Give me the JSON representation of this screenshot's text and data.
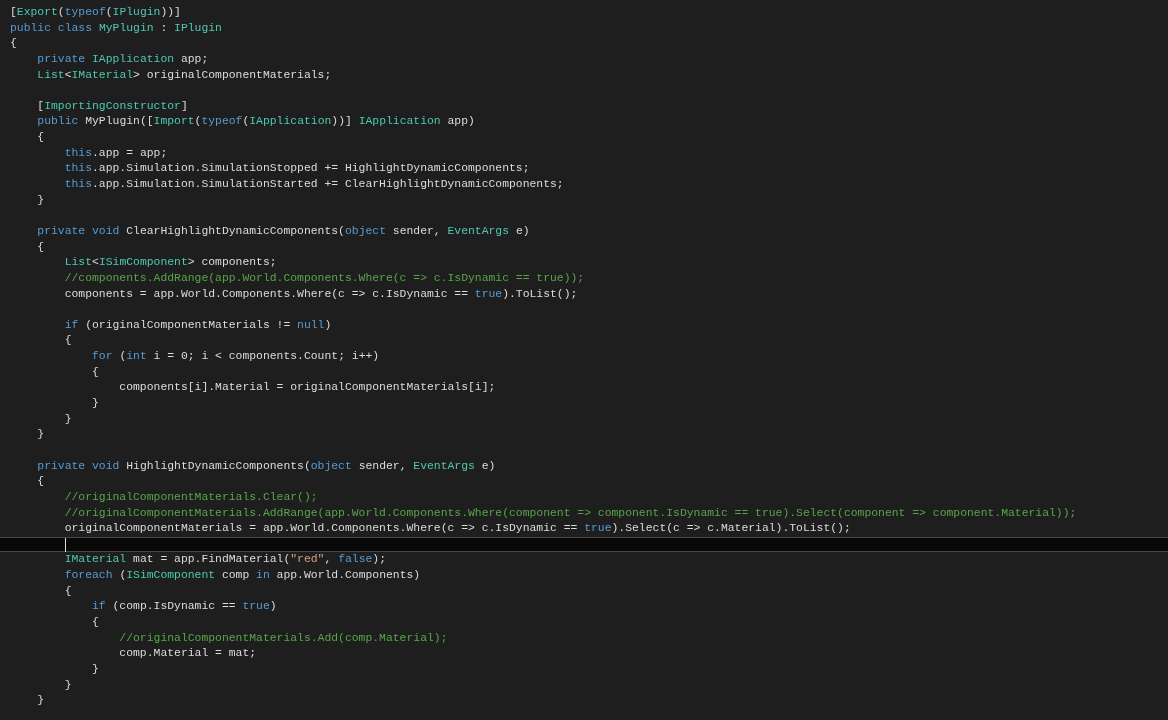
{
  "editor": {
    "lines": [
      {
        "current": false,
        "tokens": [
          {
            "text": "[",
            "kind": "plain"
          },
          {
            "text": "Export",
            "kind": "type"
          },
          {
            "text": "(",
            "kind": "plain"
          },
          {
            "text": "typeof",
            "kind": "keyword"
          },
          {
            "text": "(",
            "kind": "plain"
          },
          {
            "text": "IPlugin",
            "kind": "type"
          },
          {
            "text": "))]",
            "kind": "plain"
          }
        ]
      },
      {
        "current": false,
        "tokens": [
          {
            "text": "public class ",
            "kind": "keyword"
          },
          {
            "text": "MyPlugin",
            "kind": "type"
          },
          {
            "text": " : ",
            "kind": "plain"
          },
          {
            "text": "IPlugin",
            "kind": "type"
          }
        ]
      },
      {
        "current": false,
        "tokens": [
          {
            "text": "{",
            "kind": "plain"
          }
        ]
      },
      {
        "current": false,
        "tokens": [
          {
            "text": "    private ",
            "kind": "keyword"
          },
          {
            "text": "IApplication",
            "kind": "type"
          },
          {
            "text": " app;",
            "kind": "plain"
          }
        ]
      },
      {
        "current": false,
        "tokens": [
          {
            "text": "    List",
            "kind": "type"
          },
          {
            "text": "<",
            "kind": "plain"
          },
          {
            "text": "IMaterial",
            "kind": "type"
          },
          {
            "text": "> originalComponentMaterials;",
            "kind": "plain"
          }
        ]
      },
      {
        "current": false
      },
      {
        "current": false,
        "tokens": [
          {
            "text": "    [",
            "kind": "plain"
          },
          {
            "text": "ImportingConstructor",
            "kind": "type"
          },
          {
            "text": "]",
            "kind": "plain"
          }
        ]
      },
      {
        "current": false,
        "tokens": [
          {
            "text": "    public ",
            "kind": "keyword"
          },
          {
            "text": "MyPlugin([",
            "kind": "plain"
          },
          {
            "text": "Import",
            "kind": "type"
          },
          {
            "text": "(",
            "kind": "plain"
          },
          {
            "text": "typeof",
            "kind": "keyword"
          },
          {
            "text": "(",
            "kind": "plain"
          },
          {
            "text": "IApplication",
            "kind": "type"
          },
          {
            "text": "))] ",
            "kind": "plain"
          },
          {
            "text": "IApplication",
            "kind": "type"
          },
          {
            "text": " app)",
            "kind": "plain"
          }
        ]
      },
      {
        "current": false,
        "tokens": [
          {
            "text": "    {",
            "kind": "plain"
          }
        ]
      },
      {
        "current": false,
        "tokens": [
          {
            "text": "        this",
            "kind": "keyword"
          },
          {
            "text": ".app = app;",
            "kind": "plain"
          }
        ]
      },
      {
        "current": false,
        "tokens": [
          {
            "text": "        this",
            "kind": "keyword"
          },
          {
            "text": ".app.Simulation.SimulationStopped += HighlightDynamicComponents;",
            "kind": "plain"
          }
        ]
      },
      {
        "current": false,
        "tokens": [
          {
            "text": "        this",
            "kind": "keyword"
          },
          {
            "text": ".app.Simulation.SimulationStarted += ClearHighlightDynamicComponents;",
            "kind": "plain"
          }
        ]
      },
      {
        "current": false,
        "tokens": [
          {
            "text": "    }",
            "kind": "plain"
          }
        ]
      },
      {
        "current": false
      },
      {
        "current": false,
        "tokens": [
          {
            "text": "    private void ",
            "kind": "keyword"
          },
          {
            "text": "ClearHighlightDynamicComponents(",
            "kind": "plain"
          },
          {
            "text": "object",
            "kind": "keyword"
          },
          {
            "text": " sender, ",
            "kind": "plain"
          },
          {
            "text": "EventArgs",
            "kind": "type"
          },
          {
            "text": " e)",
            "kind": "plain"
          }
        ]
      },
      {
        "current": false,
        "tokens": [
          {
            "text": "    {",
            "kind": "plain"
          }
        ]
      },
      {
        "current": false,
        "tokens": [
          {
            "text": "        List",
            "kind": "type"
          },
          {
            "text": "<",
            "kind": "plain"
          },
          {
            "text": "ISimComponent",
            "kind": "type"
          },
          {
            "text": "> components;",
            "kind": "plain"
          }
        ]
      },
      {
        "current": false,
        "tokens": [
          {
            "text": "        //components.AddRange(app.World.Components.Where(c => c.IsDynamic == true));",
            "kind": "comment"
          }
        ]
      },
      {
        "current": false,
        "tokens": [
          {
            "text": "        components = app.World.Components.Where(c => c.IsDynamic == ",
            "kind": "plain"
          },
          {
            "text": "true",
            "kind": "keyword"
          },
          {
            "text": ").ToList();",
            "kind": "plain"
          }
        ]
      },
      {
        "current": false
      },
      {
        "current": false,
        "tokens": [
          {
            "text": "        if",
            "kind": "keyword"
          },
          {
            "text": " (originalComponentMaterials != ",
            "kind": "plain"
          },
          {
            "text": "null",
            "kind": "keyword"
          },
          {
            "text": ")",
            "kind": "plain"
          }
        ]
      },
      {
        "current": false,
        "tokens": [
          {
            "text": "        {",
            "kind": "plain"
          }
        ]
      },
      {
        "current": false,
        "tokens": [
          {
            "text": "            for",
            "kind": "keyword"
          },
          {
            "text": " (",
            "kind": "plain"
          },
          {
            "text": "int",
            "kind": "keyword"
          },
          {
            "text": " i = 0; i < components.Count; i++)",
            "kind": "plain"
          }
        ]
      },
      {
        "current": false,
        "tokens": [
          {
            "text": "            {",
            "kind": "plain"
          }
        ]
      },
      {
        "current": false,
        "tokens": [
          {
            "text": "                components[i].Material = originalComponentMaterials[i];",
            "kind": "plain"
          }
        ]
      },
      {
        "current": false,
        "tokens": [
          {
            "text": "            }",
            "kind": "plain"
          }
        ]
      },
      {
        "current": false,
        "tokens": [
          {
            "text": "        }",
            "kind": "plain"
          }
        ]
      },
      {
        "current": false,
        "tokens": [
          {
            "text": "    }",
            "kind": "plain"
          }
        ]
      },
      {
        "current": false
      },
      {
        "current": false,
        "tokens": [
          {
            "text": "    private void ",
            "kind": "keyword"
          },
          {
            "text": "HighlightDynamicComponents(",
            "kind": "plain"
          },
          {
            "text": "object",
            "kind": "keyword"
          },
          {
            "text": " sender, ",
            "kind": "plain"
          },
          {
            "text": "EventArgs",
            "kind": "type"
          },
          {
            "text": " e)",
            "kind": "plain"
          }
        ]
      },
      {
        "current": false,
        "tokens": [
          {
            "text": "    {",
            "kind": "plain"
          }
        ]
      },
      {
        "current": false,
        "tokens": [
          {
            "text": "        //originalComponentMaterials.Clear();",
            "kind": "comment"
          }
        ]
      },
      {
        "current": false,
        "tokens": [
          {
            "text": "        //originalComponentMaterials.AddRange(app.World.Components.Where(component => component.IsDynamic == true).Select(component => component.Material));",
            "kind": "comment"
          }
        ]
      },
      {
        "current": false,
        "tokens": [
          {
            "text": "        originalComponentMaterials = app.World.Components.Where(c => c.IsDynamic == ",
            "kind": "plain"
          },
          {
            "text": "true",
            "kind": "keyword"
          },
          {
            "text": ").Select(c => c.Material).ToList();",
            "kind": "plain"
          }
        ]
      },
      {
        "current": true
      },
      {
        "current": false,
        "tokens": [
          {
            "text": "        IMaterial",
            "kind": "type"
          },
          {
            "text": " mat = app.FindMaterial(",
            "kind": "plain"
          },
          {
            "text": "\"red\"",
            "kind": "string"
          },
          {
            "text": ", ",
            "kind": "plain"
          },
          {
            "text": "false",
            "kind": "keyword"
          },
          {
            "text": ");",
            "kind": "plain"
          }
        ]
      },
      {
        "current": false,
        "tokens": [
          {
            "text": "        foreach",
            "kind": "keyword"
          },
          {
            "text": " (",
            "kind": "plain"
          },
          {
            "text": "ISimComponent",
            "kind": "type"
          },
          {
            "text": " comp ",
            "kind": "plain"
          },
          {
            "text": "in",
            "kind": "keyword"
          },
          {
            "text": " app.World.Components)",
            "kind": "plain"
          }
        ]
      },
      {
        "current": false,
        "tokens": [
          {
            "text": "        {",
            "kind": "plain"
          }
        ]
      },
      {
        "current": false,
        "tokens": [
          {
            "text": "            if",
            "kind": "keyword"
          },
          {
            "text": " (comp.IsDynamic == ",
            "kind": "plain"
          },
          {
            "text": "true",
            "kind": "keyword"
          },
          {
            "text": ")",
            "kind": "plain"
          }
        ]
      },
      {
        "current": false,
        "tokens": [
          {
            "text": "            {",
            "kind": "plain"
          }
        ]
      },
      {
        "current": false,
        "tokens": [
          {
            "text": "                //originalComponentMaterials.Add(comp.Material);",
            "kind": "comment"
          }
        ]
      },
      {
        "current": false,
        "tokens": [
          {
            "text": "                comp.Material = mat;",
            "kind": "plain"
          }
        ]
      },
      {
        "current": false,
        "tokens": [
          {
            "text": "            }",
            "kind": "plain"
          }
        ]
      },
      {
        "current": false,
        "tokens": [
          {
            "text": "        }",
            "kind": "plain"
          }
        ]
      },
      {
        "current": false,
        "tokens": [
          {
            "text": "    }",
            "kind": "plain"
          }
        ]
      }
    ]
  }
}
